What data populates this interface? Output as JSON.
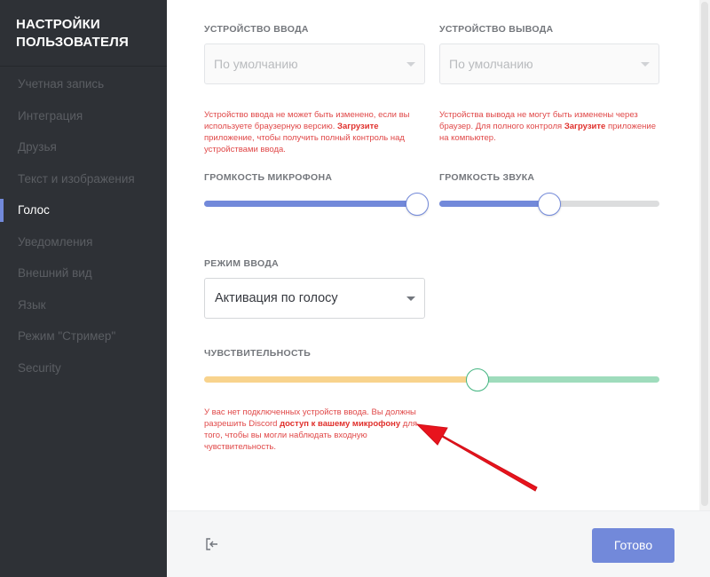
{
  "sidebar": {
    "title": "НАСТРОЙКИ\nПОЛЬЗОВАТЕЛЯ",
    "items": [
      {
        "label": "Учетная запись",
        "active": false
      },
      {
        "label": "Интеграция",
        "active": false
      },
      {
        "label": "Друзья",
        "active": false
      },
      {
        "label": "Текст и изображения",
        "active": false
      },
      {
        "label": "Голос",
        "active": true
      },
      {
        "label": "Уведомления",
        "active": false
      },
      {
        "label": "Внешний вид",
        "active": false
      },
      {
        "label": "Язык",
        "active": false
      },
      {
        "label": "Режим \"Стример\"",
        "active": false
      },
      {
        "label": "Security",
        "active": false
      }
    ]
  },
  "input_device": {
    "label": "УСТРОЙСТВО ВВОДА",
    "value": "По умолчанию",
    "error_pre": "Устройство ввода не может быть изменено, если вы используете браузерную версию. ",
    "error_link": "Загрузите",
    "error_post": " приложение, чтобы получить полный контроль над устройствами ввода."
  },
  "output_device": {
    "label": "УСТРОЙСТВО ВЫВОДА",
    "value": "По умолчанию",
    "error_pre": "Устройства вывода не могут быть изменены через браузер. Для полного контроля ",
    "error_link": "Загрузите",
    "error_post": " приложение на компьютер."
  },
  "mic_volume": {
    "label": "ГРОМКОСТЬ МИКРОФОНА",
    "level": 0.96
  },
  "sound_volume": {
    "label": "ГРОМКОСТЬ ЗВУКА",
    "level": 0.5
  },
  "input_mode": {
    "label": "РЕЖИМ ВВОДА",
    "value": "Активация по голосу"
  },
  "sensitivity": {
    "label": "ЧУВСТВИТЕЛЬНОСТЬ",
    "level": 0.6,
    "error_pre": "У вас нет подключенных устройств ввода. Вы должны разрешить Discord ",
    "error_link": "доступ к вашему микрофону",
    "error_post": " для того, чтобы вы могли наблюдать входную чувствительность."
  },
  "footer": {
    "done_label": "Готово"
  },
  "colors": {
    "sidebar_bg": "#2e3136",
    "accent": "#7289da",
    "error": "#e04848",
    "sensitivity_low": "#f8d38d",
    "sensitivity_high": "#9fdcbc",
    "annotation_arrow": "#e8131d"
  },
  "icons": {
    "exit": "exit-icon",
    "caret": "chevron-down-icon"
  }
}
